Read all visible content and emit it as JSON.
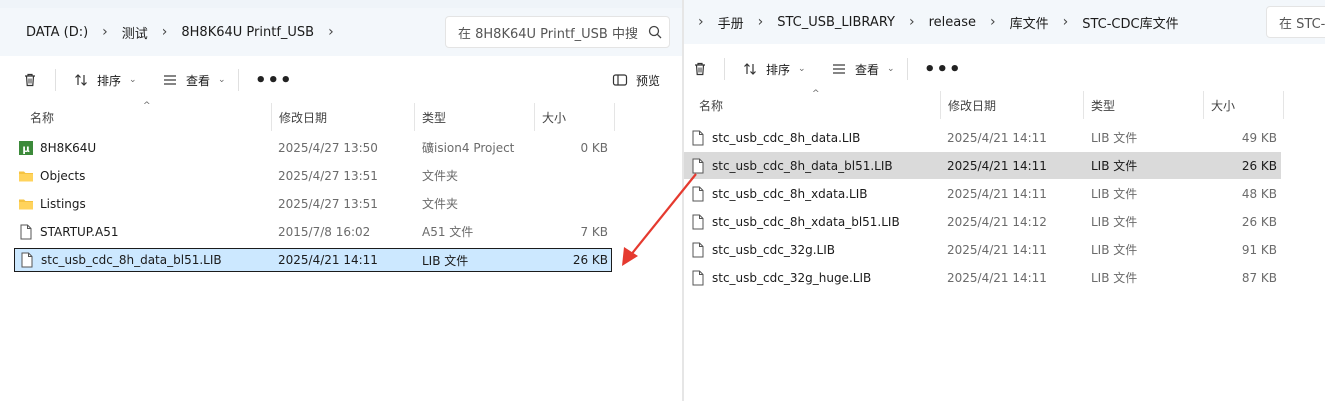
{
  "left": {
    "breadcrumbs": [
      "DATA (D:)",
      "测试",
      "8H8K64U Printf_USB"
    ],
    "search_placeholder": "在 8H8K64U Printf_USB 中搜",
    "toolbar": {
      "sort_label": "排序",
      "view_label": "查看",
      "more_label": "•••",
      "preview_label": "预览"
    },
    "columns": {
      "name": "名称",
      "date": "修改日期",
      "type": "类型",
      "size": "大小"
    },
    "files": [
      {
        "name": "8H8K64U",
        "date": "2025/4/27 13:50",
        "type": "礦ision4 Project",
        "size": "0 KB",
        "icon": "keil-project-icon"
      },
      {
        "name": "Objects",
        "date": "2025/4/27 13:51",
        "type": "文件夹",
        "size": "",
        "icon": "folder-icon"
      },
      {
        "name": "Listings",
        "date": "2025/4/27 13:51",
        "type": "文件夹",
        "size": "",
        "icon": "folder-icon"
      },
      {
        "name": "STARTUP.A51",
        "date": "2015/7/8 16:02",
        "type": "A51 文件",
        "size": "7 KB",
        "icon": "file-icon"
      },
      {
        "name": "stc_usb_cdc_8h_data_bl51.LIB",
        "date": "2025/4/21 14:11",
        "type": "LIB 文件",
        "size": "26 KB",
        "icon": "file-icon",
        "selected": true
      }
    ]
  },
  "right": {
    "breadcrumbs": [
      "手册",
      "STC_USB_LIBRARY",
      "release",
      "库文件",
      "STC-CDC库文件"
    ],
    "search_placeholder": "在 STC-",
    "toolbar": {
      "sort_label": "排序",
      "view_label": "查看",
      "more_label": "•••"
    },
    "columns": {
      "name": "名称",
      "date": "修改日期",
      "type": "类型",
      "size": "大小"
    },
    "files": [
      {
        "name": "stc_usb_cdc_8h_data.LIB",
        "date": "2025/4/21 14:11",
        "type": "LIB 文件",
        "size": "49 KB",
        "icon": "file-icon"
      },
      {
        "name": "stc_usb_cdc_8h_data_bl51.LIB",
        "date": "2025/4/21 14:11",
        "type": "LIB 文件",
        "size": "26 KB",
        "icon": "file-icon",
        "highlighted": true
      },
      {
        "name": "stc_usb_cdc_8h_xdata.LIB",
        "date": "2025/4/21 14:11",
        "type": "LIB 文件",
        "size": "48 KB",
        "icon": "file-icon"
      },
      {
        "name": "stc_usb_cdc_8h_xdata_bl51.LIB",
        "date": "2025/4/21 14:12",
        "type": "LIB 文件",
        "size": "26 KB",
        "icon": "file-icon"
      },
      {
        "name": "stc_usb_cdc_32g.LIB",
        "date": "2025/4/21 14:11",
        "type": "LIB 文件",
        "size": "91 KB",
        "icon": "file-icon"
      },
      {
        "name": "stc_usb_cdc_32g_huge.LIB",
        "date": "2025/4/21 14:11",
        "type": "LIB 文件",
        "size": "87 KB",
        "icon": "file-icon"
      }
    ]
  },
  "annotation": {
    "arrow_color": "#e53a2f"
  }
}
